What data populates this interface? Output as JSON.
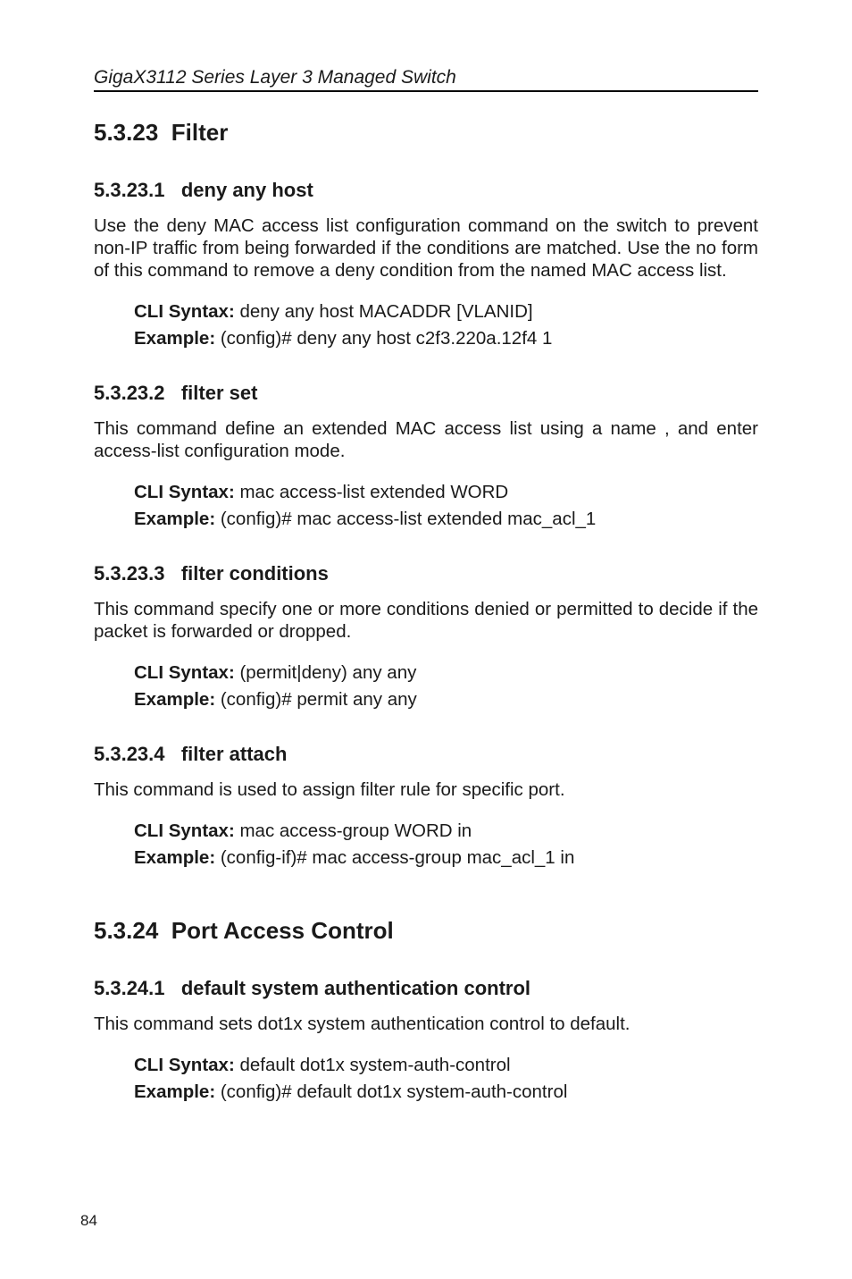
{
  "header": {
    "running": "GigaX3112 Series Layer 3 Managed Switch"
  },
  "page_number": "84",
  "labels": {
    "cli_syntax": "CLI Syntax: ",
    "example": "Example:  "
  },
  "sections": [
    {
      "number": "5.3.23",
      "title": "Filter",
      "subsections": [
        {
          "number": "5.3.23.1",
          "title": "deny any host",
          "body": "Use the deny MAC access list configuration command on the switch to prevent non-IP traffic from being forwarded if the conditions are matched. Use the no form of this command to remove a deny condition from the named MAC access list.",
          "cli_syntax": "deny any host MACADDR [VLANID]",
          "example": "(config)# deny any host c2f3.220a.12f4 1"
        },
        {
          "number": "5.3.23.2",
          "title": "filter set",
          "body": "This command define an extended MAC access list using a name , and enter access-list configuration mode.",
          "cli_syntax": "mac access-list extended WORD",
          "example": "(config)# mac access-list extended mac_acl_1"
        },
        {
          "number": "5.3.23.3",
          "title": "filter conditions",
          "body": "This command specify one or more conditions denied or permitted to decide if the packet is forwarded or dropped.",
          "cli_syntax": "(permit|deny) any any",
          "example": "(config)# permit any any"
        },
        {
          "number": "5.3.23.4",
          "title": "filter attach",
          "body": "This command is used to assign filter rule for specific port.",
          "cli_syntax": "mac access-group WORD in",
          "example": "(config-if)# mac access-group mac_acl_1 in"
        }
      ]
    },
    {
      "number": "5.3.24",
      "title": "Port Access Control",
      "subsections": [
        {
          "number": "5.3.24.1",
          "title": "default system authentication control",
          "body": "This command sets dot1x system authentication control to default.",
          "cli_syntax": "default dot1x system-auth-control",
          "example": "(config)# default dot1x system-auth-control"
        }
      ]
    }
  ]
}
